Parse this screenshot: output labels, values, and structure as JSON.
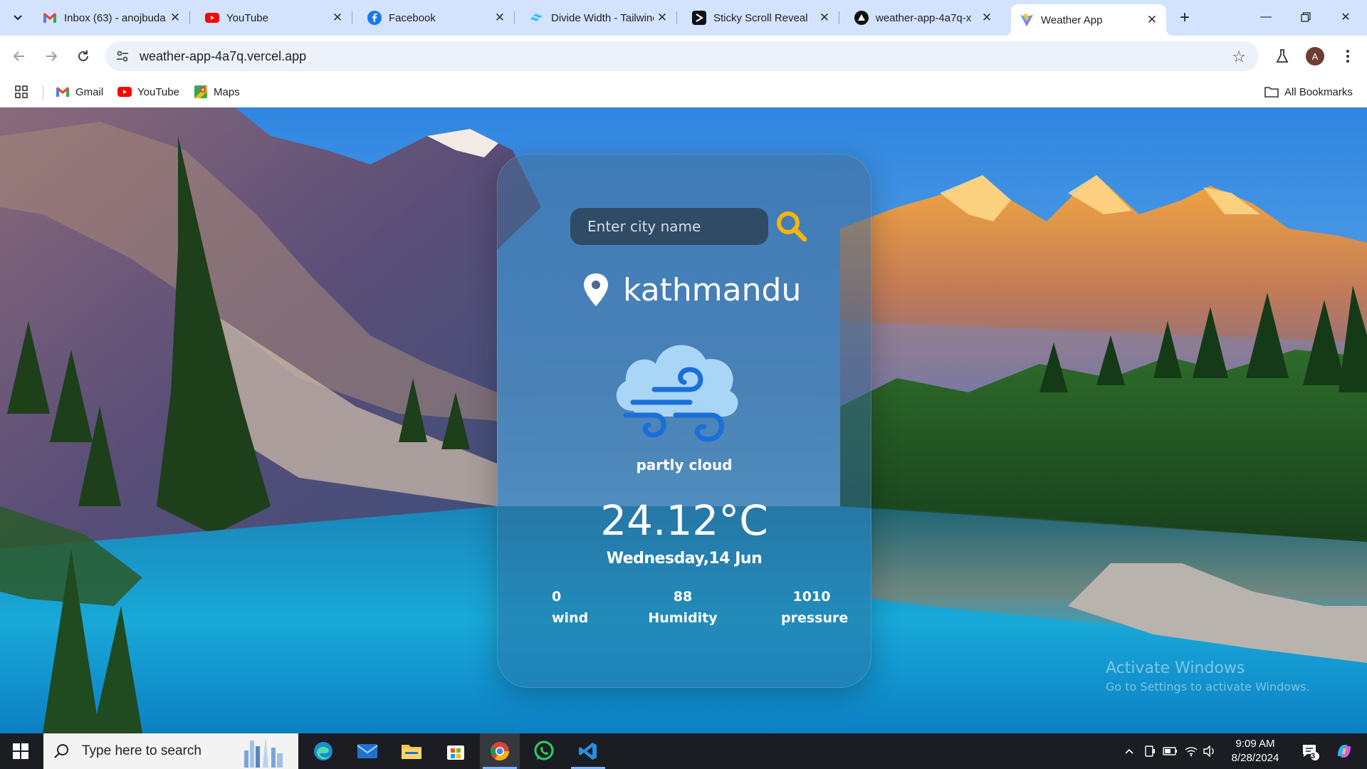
{
  "browser": {
    "tabs": [
      {
        "title": "Inbox (63) - anojbuda",
        "favicon": "gmail-icon"
      },
      {
        "title": "YouTube",
        "favicon": "youtube-icon"
      },
      {
        "title": "Facebook",
        "favicon": "facebook-icon"
      },
      {
        "title": "Divide Width - Tailwind",
        "favicon": "tailwind-icon"
      },
      {
        "title": "Sticky Scroll Reveal",
        "favicon": "sticky-scroll-icon"
      },
      {
        "title": "weather-app-4a7q-x",
        "favicon": "vercel-icon"
      },
      {
        "title": "Weather App",
        "favicon": "vite-icon",
        "active": true
      }
    ],
    "url": "weather-app-4a7q.vercel.app",
    "profile_initial": "A",
    "bookmarks": [
      {
        "label": "Gmail",
        "icon": "gmail-icon"
      },
      {
        "label": "YouTube",
        "icon": "youtube-icon"
      },
      {
        "label": "Maps",
        "icon": "maps-icon"
      }
    ],
    "all_bookmarks_label": "All Bookmarks"
  },
  "weather": {
    "search_placeholder": "Enter city name",
    "search_value": "",
    "city": "kathmandu",
    "condition": "partly cloud",
    "temperature": "24.12°C",
    "date": "Wednesday,14 Jun",
    "stats": [
      {
        "value": "0",
        "label": "wind"
      },
      {
        "value": "88",
        "label": "Humidity"
      },
      {
        "value": "1010",
        "label": "pressure"
      }
    ]
  },
  "watermark": {
    "line1": "Activate Windows",
    "line2": "Go to Settings to activate Windows."
  },
  "taskbar": {
    "search_placeholder": "Type here to search",
    "time": "9:09 AM",
    "date": "8/28/2024",
    "notification_count": "3"
  },
  "colors": {
    "tab_strip": "#d3e3fd",
    "search_icon": "#f5b50a",
    "cloud": "#a9d6f6",
    "wind": "#1a6fd8"
  }
}
